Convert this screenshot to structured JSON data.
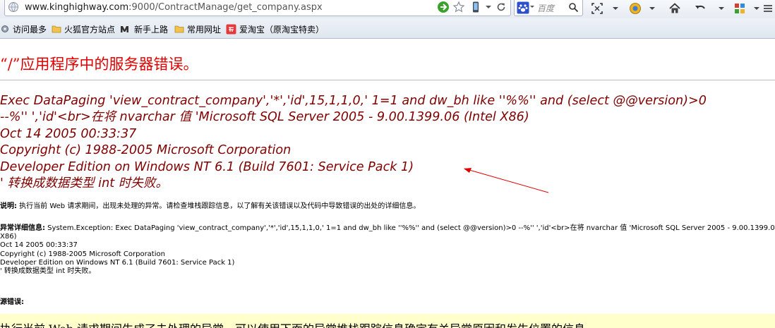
{
  "browser": {
    "url_host": "www.kinghighway.com",
    "url_path": ":9000/ContractManage/get_company.aspx",
    "search_placeholder": "百度",
    "bookmarks": [
      {
        "label": "访问最多"
      },
      {
        "label": "火狐官方站点"
      },
      {
        "label": "新手上路"
      },
      {
        "label": "常用网址"
      },
      {
        "label": "爱淘宝（原淘宝特卖）"
      }
    ]
  },
  "page": {
    "error_title": "“/”应用程序中的服务器错误。",
    "message_lines": [
      "Exec DataPaging 'view_contract_company','*','id',15,1,1,0,' 1=1  and dw_bh like ''%%'' and (select @@version)>0",
      "--%'' ','id'<br>在将 nvarchar 值 'Microsoft SQL Server 2005 - 9.00.1399.06 (Intel X86)",
      "Oct 14 2005 00:33:37",
      "Copyright (c) 1988-2005 Microsoft Corporation",
      "Developer Edition on Windows NT 6.1 (Build 7601: Service Pack 1)",
      "' 转换成数据类型 int 时失败。"
    ],
    "description_label": "说明:",
    "description_text": " 执行当前 Web 请求期间，出现未处理的异常。请检查堆栈跟踪信息，以了解有关该错误以及代码中导致错误的出处的详细信息。",
    "exception_label": "异常详细信息:",
    "exception_lines": [
      " System.Exception: Exec DataPaging 'view_contract_company','*','id',15,1,1,0,' 1=1  and dw_bh like ''%%'' and (select @@version)>0 --%'' ','id'<br>在将 nvarchar 值 'Microsoft SQL Server 2005 - 9.00.1399.06 (Intel",
      "X86)",
      "Oct 14 2005 00:33:37",
      "Copyright (c) 1988-2005 Microsoft Corporation",
      "Developer Edition on Windows NT 6.1 (Build 7601: Service Pack 1)",
      "' 转换成数据类型 int 时失败。"
    ],
    "source_error_label": "源错误:",
    "source_error_text": "执行当前 Web 请求期间生成了未处理的异常。可以使用下面的异常堆栈跟踪信息确定有关异常原因和发生位置的信息。"
  },
  "colors": {
    "title": "#e00000",
    "message": "#800000",
    "arrow": "#e00000",
    "source_bg": "#ffffcc"
  }
}
